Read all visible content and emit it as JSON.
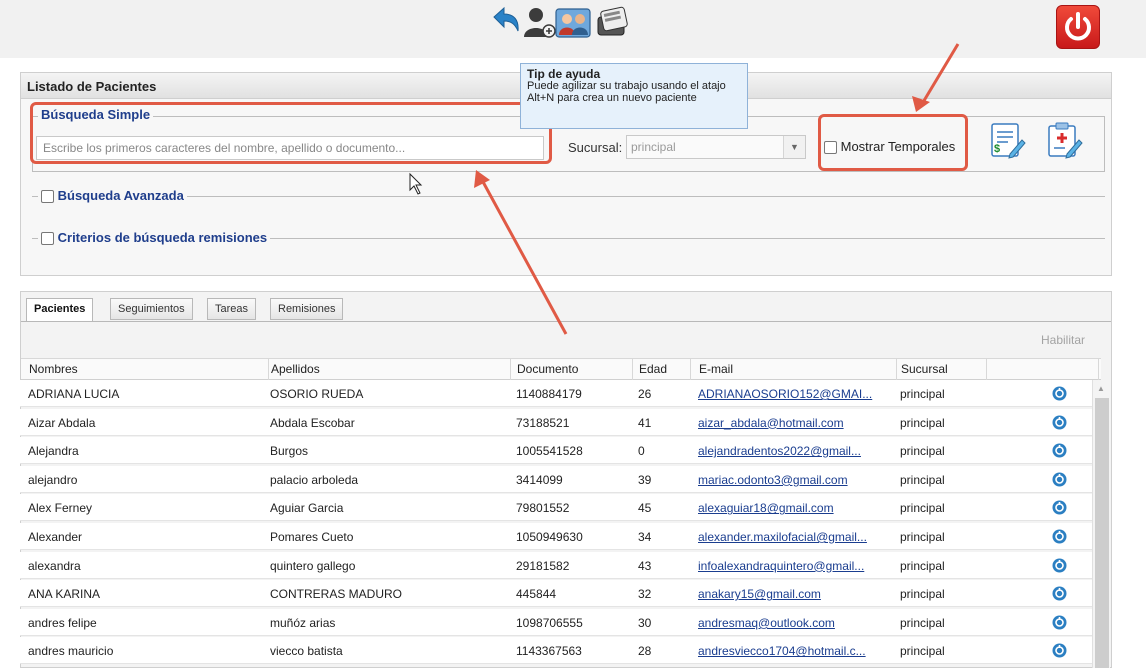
{
  "tooltip": {
    "title": "Tip de ayuda",
    "body": "Puede agilizar su trabajo usando el atajo Alt+N para crea un nuevo paciente"
  },
  "panel": {
    "title": "Listado de Pacientes",
    "simple_search_legend": "Búsqueda Simple",
    "search_placeholder": "Escribe los primeros caracteres del nombre, apellido o documento...",
    "branch_label": "Sucursal:",
    "branch_value": "principal",
    "show_temp_label": "Mostrar Temporales",
    "advanced_search_label": "Búsqueda Avanzada",
    "referral_criteria_label": "Criterios de búsqueda remisiones"
  },
  "tabs": [
    {
      "label": "Pacientes",
      "active": true
    },
    {
      "label": "Seguimientos",
      "active": false
    },
    {
      "label": "Tareas",
      "active": false
    },
    {
      "label": "Remisiones",
      "active": false
    }
  ],
  "grid": {
    "enable_label": "Habilitar",
    "columns": [
      "Nombres",
      "Apellidos",
      "Documento",
      "Edad",
      "E-mail",
      "Sucursal"
    ],
    "rows": [
      {
        "nombres": "ADRIANA LUCIA",
        "apellidos": "OSORIO RUEDA",
        "documento": "1140884179",
        "edad": "26",
        "email": "ADRIANAOSORIO152@GMAI...",
        "sucursal": "principal"
      },
      {
        "nombres": "Aizar Abdala",
        "apellidos": "Abdala Escobar",
        "documento": "73188521",
        "edad": "41",
        "email": "aizar_abdala@hotmail.com",
        "sucursal": "principal"
      },
      {
        "nombres": "Alejandra",
        "apellidos": "Burgos",
        "documento": "1005541528",
        "edad": "0",
        "email": "alejandradentos2022@gmail...",
        "sucursal": "principal"
      },
      {
        "nombres": "alejandro",
        "apellidos": "palacio arboleda",
        "documento": "3414099",
        "edad": "39",
        "email": "mariac.odonto3@gmail.com",
        "sucursal": "principal"
      },
      {
        "nombres": "Alex Ferney",
        "apellidos": "Aguiar Garcia",
        "documento": "79801552",
        "edad": "45",
        "email": "alexaguiar18@gmail.com",
        "sucursal": "principal"
      },
      {
        "nombres": "Alexander",
        "apellidos": "Pomares Cueto",
        "documento": "1050949630",
        "edad": "34",
        "email": "alexander.maxilofacial@gmail...",
        "sucursal": "principal"
      },
      {
        "nombres": "alexandra",
        "apellidos": "quintero gallego",
        "documento": "29181582",
        "edad": "43",
        "email": "infoalexandraquintero@gmail...",
        "sucursal": "principal"
      },
      {
        "nombres": "ANA KARINA",
        "apellidos": "CONTRERAS MADURO",
        "documento": "445844",
        "edad": "32",
        "email": "anakary15@gmail.com",
        "sucursal": "principal"
      },
      {
        "nombres": "andres felipe",
        "apellidos": "muñóz arias",
        "documento": "1098706555",
        "edad": "30",
        "email": "andresmaq@outlook.com",
        "sucursal": "principal"
      },
      {
        "nombres": "andres mauricio",
        "apellidos": "viecco batista",
        "documento": "1143367563",
        "edad": "28",
        "email": "andresviecco1704@hotmail.c...",
        "sucursal": "principal"
      }
    ]
  },
  "colors": {
    "accent_blue": "#1f3e8c",
    "annotation_red": "#e05a45",
    "power_red": "#d9261c"
  },
  "icons": {
    "toolbar": [
      "back-arrow-icon",
      "new-patient-icon",
      "patient-group-icon",
      "card-file-icon"
    ],
    "power": "power-icon",
    "docs": [
      "money-document-icon",
      "medical-clipboard-icon"
    ],
    "row_action": "refresh-circle-icon"
  }
}
